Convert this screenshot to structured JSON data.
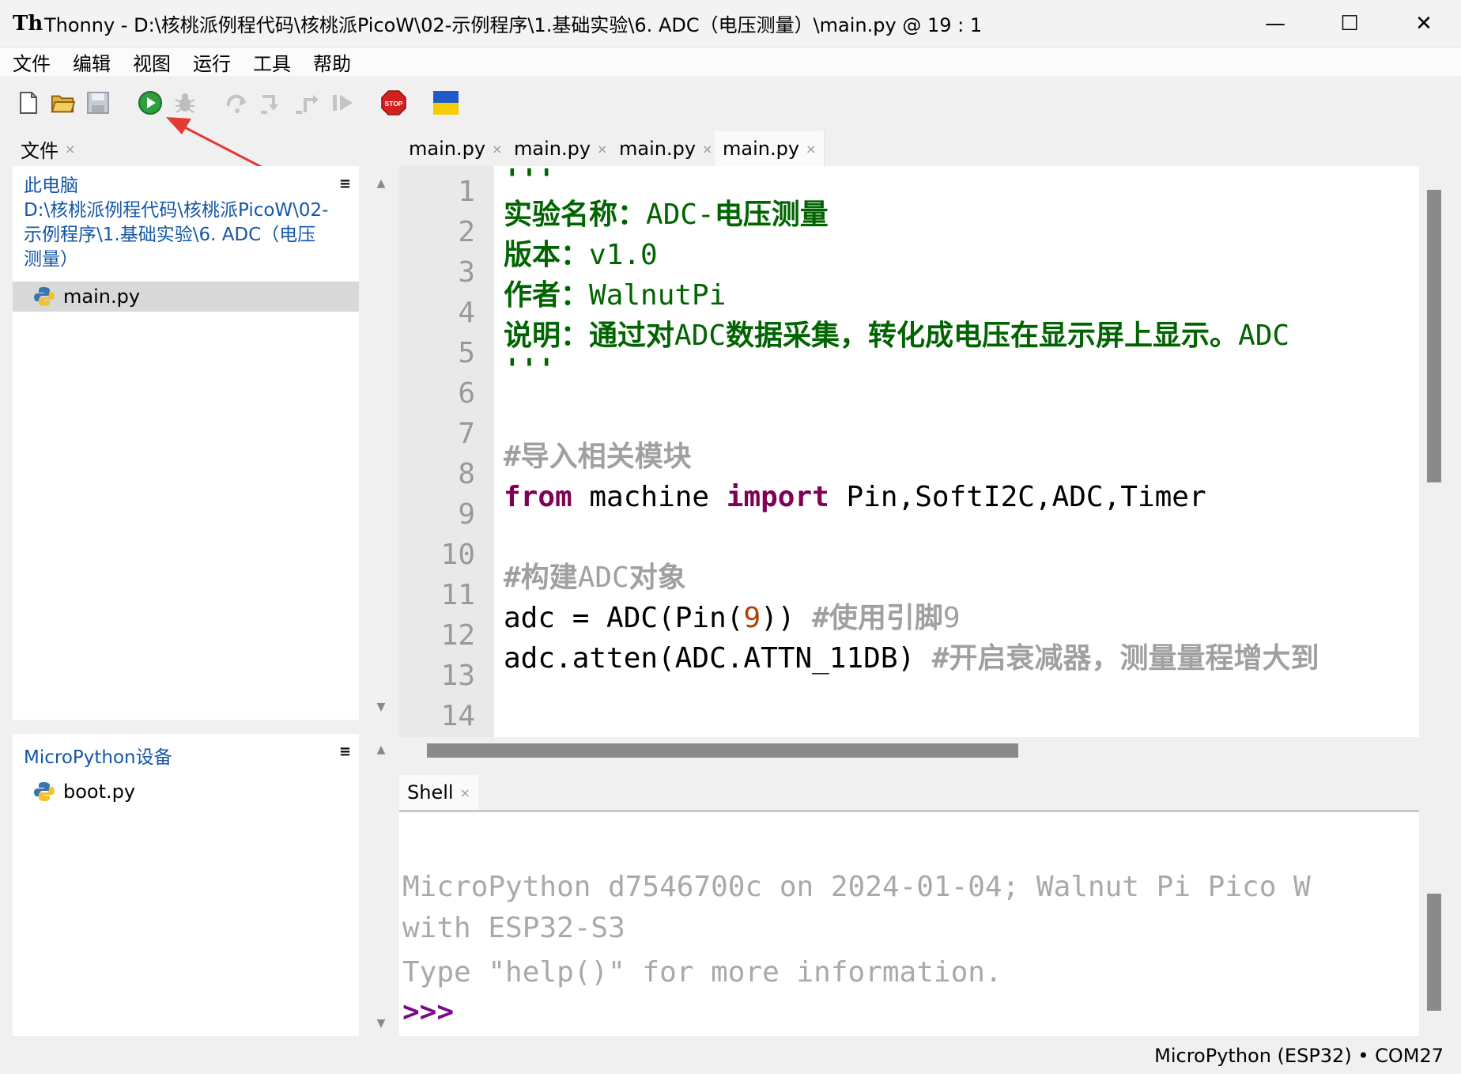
{
  "window": {
    "app_icon": "Th",
    "title": "Thonny  -  D:\\核桃派例程代码\\核桃派PicoW\\02-示例程序\\1.基础实验\\6. ADC（电压测量）\\main.py  @  19 : 1",
    "minimize": "—",
    "maximize": "☐",
    "close": "✕"
  },
  "menu": [
    "文件",
    "编辑",
    "视图",
    "运行",
    "工具",
    "帮助"
  ],
  "toolbar": {
    "icons": [
      "new-file-icon",
      "open-file-icon",
      "save-icon",
      "run-icon",
      "debug-icon",
      "step-over-icon",
      "step-into-icon",
      "step-out-icon",
      "resume-icon",
      "stop-icon",
      "ukraine-flag-icon"
    ],
    "stop_label": "STOP"
  },
  "files_panel": {
    "tab_label": "文件",
    "close": "×",
    "menu": "≡",
    "computer_label": "此电脑",
    "path": "D:\\核桃派例程代码\\核桃派PicoW\\02-示例程序\\1.基础实验\\6. ADC（电压测量）",
    "files": [
      "main.py"
    ]
  },
  "device_panel": {
    "title": "MicroPython设备",
    "menu": "≡",
    "files": [
      "boot.py"
    ]
  },
  "editor": {
    "tabs": [
      {
        "label": "main.py",
        "close": "×"
      },
      {
        "label": "main.py",
        "close": "×"
      },
      {
        "label": "main.py",
        "close": "×"
      },
      {
        "label": "main.py",
        "close": "×"
      }
    ],
    "line_numbers": [
      "1",
      "2",
      "3",
      "4",
      "5",
      "6",
      "7",
      "8",
      "9",
      "10",
      "11",
      "12",
      "13",
      "14"
    ],
    "code": {
      "l1": "'''",
      "l2_label": "实验名称：",
      "l2_value": "ADC-",
      "l2_rest": "电压测量",
      "l3_label": "版本：",
      "l3_value": "v1.0",
      "l4_label": "作者：",
      "l4_value": "WalnutPi",
      "l5_label": "说明：通过对",
      "l5_mid": "ADC",
      "l5_rest": "数据采集，转化成电压在显示屏上显示。",
      "l5_tail": "ADC",
      "l6": "'''",
      "l8": "#导入相关模块",
      "l9_from": "from",
      "l9_mod": " machine ",
      "l9_import": "import",
      "l9_names": " Pin,SoftI2C,ADC,Timer",
      "l11_a": "#构建",
      "l11_b": "ADC",
      "l11_c": "对象",
      "l12_code": "adc = ADC(Pin(",
      "l12_num": "9",
      "l12_close": ")) ",
      "l12_cmt": "#使用引脚",
      "l12_cmt_num": "9",
      "l13_code": "adc.atten(ADC.ATTN_11DB) ",
      "l13_cmt": "#开启衰减器，测量量程增大到"
    }
  },
  "shell": {
    "tab_label": "Shell",
    "close": "×",
    "lines": [
      "MicroPython d7546700c on 2024-01-04; Walnut Pi Pico W",
      "with ESP32-S3",
      "Type \"help()\" for more information."
    ],
    "prompt": ">>>"
  },
  "status": {
    "interpreter": "MicroPython (ESP32)  •  COM27"
  },
  "colors": {
    "string": "#006400",
    "keyword": "#7f0055",
    "comment": "#a0a0a0",
    "number": "#b04000",
    "link": "#1456a8",
    "annotation_arrow": "#e53935"
  }
}
